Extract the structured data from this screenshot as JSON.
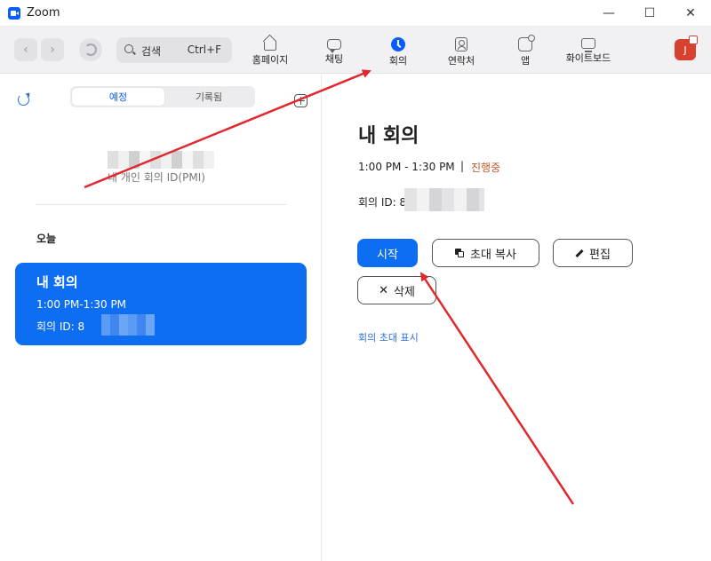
{
  "window": {
    "title": "Zoom",
    "minimize": "—",
    "maximize": "☐",
    "close": "✕"
  },
  "toolbar": {
    "back": "‹",
    "forward": "›",
    "search_label": "검색",
    "search_shortcut": "Ctrl+F",
    "tabs": [
      {
        "label": "홈페이지",
        "icon": "home-icon"
      },
      {
        "label": "채팅",
        "icon": "chat-icon"
      },
      {
        "label": "회의",
        "icon": "clock-icon",
        "active": true
      },
      {
        "label": "연락처",
        "icon": "contact-icon"
      },
      {
        "label": "앱",
        "icon": "apps-icon"
      },
      {
        "label": "화이트보드",
        "icon": "whiteboard-icon"
      }
    ],
    "avatar_initial": "J"
  },
  "sidebar": {
    "segments": [
      "예정",
      "기록됨"
    ],
    "pmi_label": "내 개인 회의 ID(PMI)",
    "section_today": "오늘",
    "meeting": {
      "title": "내 회의",
      "time": "1:00 PM-1:30 PM",
      "id_label": "회의 ID: 8"
    }
  },
  "detail": {
    "title": "내 회의",
    "time": "1:00 PM - 1:30 PM",
    "separator": "|",
    "status": "진행중",
    "id_label": "회의 ID: 8",
    "buttons": {
      "start": "시작",
      "copy_invite": "초대 복사",
      "edit": "편집",
      "delete": "삭제"
    },
    "show_invite_link": "회의 초대 표시"
  },
  "colors": {
    "accent": "#0e6ef2",
    "status": "#c0572b",
    "annotation_arrow": "#e0282e",
    "avatar": "#d8412f"
  }
}
